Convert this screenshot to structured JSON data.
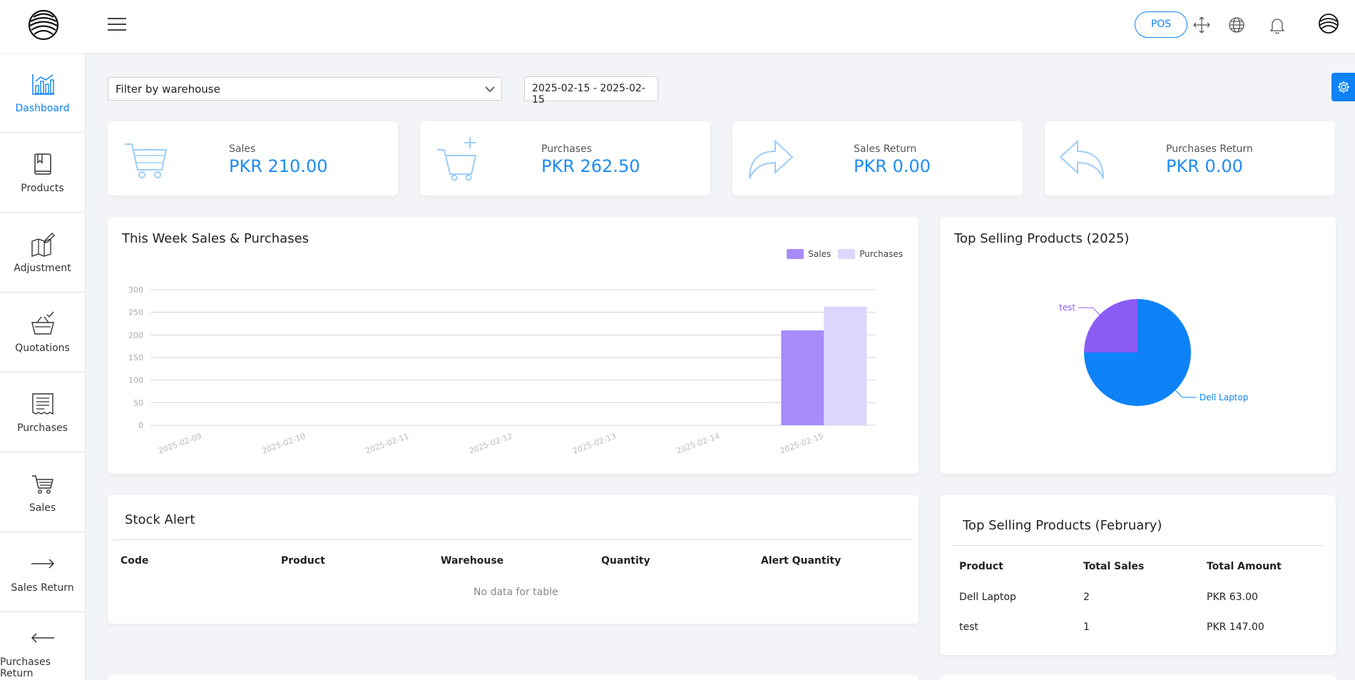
{
  "topbar": {
    "pos_label": "POS",
    "icons": [
      "logo-icon",
      "hamburger-icon",
      "fullscreen-icon",
      "globe-icon",
      "bell-icon",
      "avatar-icon"
    ]
  },
  "sidebar": {
    "items": [
      {
        "label": "Dashboard",
        "icon": "dashboard-chart-icon",
        "active": true
      },
      {
        "label": "Products",
        "icon": "book-icon"
      },
      {
        "label": "Adjustment",
        "icon": "adjustment-icon"
      },
      {
        "label": "Quotations",
        "icon": "basket-check-icon"
      },
      {
        "label": "Purchases",
        "icon": "receipt-icon"
      },
      {
        "label": "Sales",
        "icon": "cart-icon"
      },
      {
        "label": "Sales Return",
        "icon": "arrow-right-icon"
      },
      {
        "label": "Purchases Return",
        "icon": "arrow-left-icon"
      }
    ]
  },
  "filters": {
    "warehouse_placeholder": "Filter by warehouse",
    "date_range": "2025-02-15 - 2025-02-15"
  },
  "stats": [
    {
      "label": "Sales",
      "value": "PKR 210.00",
      "icon": "cart-icon"
    },
    {
      "label": "Purchases",
      "value": "PKR 262.50",
      "icon": "cart-plus-icon"
    },
    {
      "label": "Sales Return",
      "value": "PKR 0.00",
      "icon": "share-arrow-icon"
    },
    {
      "label": "Purchases Return",
      "value": "PKR 0.00",
      "icon": "reply-arrow-icon"
    }
  ],
  "weekly_chart": {
    "title": "This Week Sales & Purchases"
  },
  "pie": {
    "title": "Top Selling Products (2025)"
  },
  "chart_data": [
    {
      "type": "bar",
      "title": "This Week Sales & Purchases",
      "categories": [
        "2025-02-09",
        "2025-02-10",
        "2025-02-11",
        "2025-02-12",
        "2025-02-13",
        "2025-02-14",
        "2025-02-15"
      ],
      "series": [
        {
          "name": "Sales",
          "values": [
            0,
            0,
            0,
            0,
            0,
            0,
            210
          ],
          "color": "#a78bfa"
        },
        {
          "name": "Purchases",
          "values": [
            0,
            0,
            0,
            0,
            0,
            0,
            262.5
          ],
          "color": "#ddd6fe"
        }
      ],
      "yticks": [
        0,
        50,
        100,
        150,
        200,
        250,
        300
      ],
      "ylim": [
        0,
        300
      ],
      "grid": true,
      "legend": "top-right"
    },
    {
      "type": "pie",
      "title": "Top Selling Products (2025)",
      "slices": [
        {
          "label": "Dell Laptop",
          "value": 75,
          "color": "#0d83f7"
        },
        {
          "label": "test",
          "value": 25,
          "color": "#8b5cf6"
        }
      ]
    }
  ],
  "stock_alert": {
    "title": "Stock Alert",
    "columns": [
      "Code",
      "Product",
      "Warehouse",
      "Quantity",
      "Alert Quantity"
    ],
    "empty": "No data for table"
  },
  "top_selling_month": {
    "title": "Top Selling Products (February)",
    "columns": [
      "Product",
      "Total Sales",
      "Total Amount"
    ],
    "rows": [
      [
        "Dell Laptop",
        "2",
        "PKR 63.00"
      ],
      [
        "test",
        "1",
        "PKR 147.00"
      ]
    ]
  },
  "colors": {
    "accent": "#0d83f7",
    "sales_bar": "#a78bfa",
    "purchase_bar": "#ddd6fe"
  }
}
